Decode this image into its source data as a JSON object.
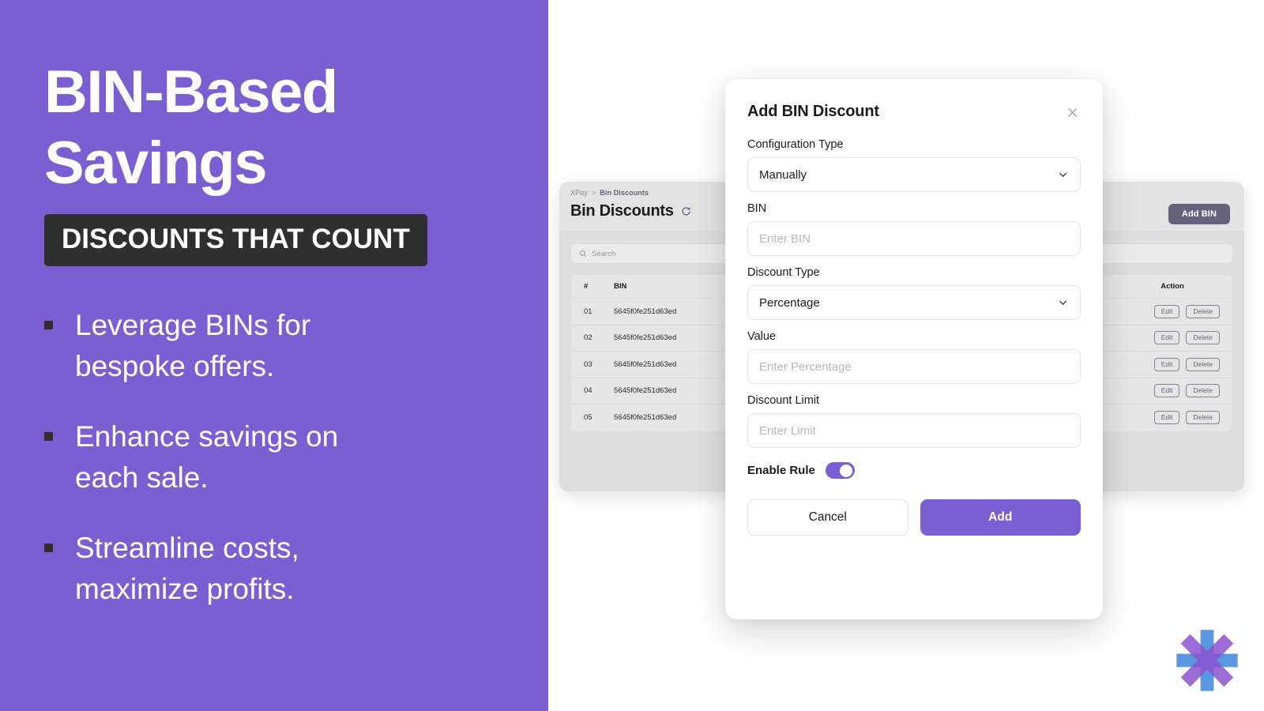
{
  "slide": {
    "headline_lines": [
      "BIN-Based",
      "Savings"
    ],
    "kicker": "DISCOUNTS THAT COUNT",
    "bullets": [
      "Leverage BINs for bespoke offers.",
      "Enhance savings on each sale.",
      "Streamline costs, maximize profits."
    ],
    "accent_purple": "#7a5fd3",
    "kicker_bg": "#2f2f2f"
  },
  "app": {
    "breadcrumb": {
      "root": "XPay",
      "separator": ">",
      "current": "Bin Discounts"
    },
    "page_title": "Bin Discounts",
    "refresh_icon": "refresh-icon",
    "add_bin_label": "Add BIN",
    "search_placeholder": "Search",
    "search_icon": "search-icon",
    "table": {
      "columns": [
        "#",
        "BIN",
        "Action"
      ],
      "rows": [
        {
          "num": "01",
          "bin": "5645f0fe251d63ed",
          "edit": "Edit",
          "delete": "Delete"
        },
        {
          "num": "02",
          "bin": "5645f0fe251d63ed",
          "edit": "Edit",
          "delete": "Delete"
        },
        {
          "num": "03",
          "bin": "5645f0fe251d63ed",
          "edit": "Edit",
          "delete": "Delete"
        },
        {
          "num": "04",
          "bin": "5645f0fe251d63ed",
          "edit": "Edit",
          "delete": "Delete"
        },
        {
          "num": "05",
          "bin": "5645f0fe251d63ed",
          "edit": "Edit",
          "delete": "Delete"
        }
      ]
    }
  },
  "modal": {
    "title": "Add BIN Discount",
    "close_icon": "close-icon",
    "fields": {
      "configuration_type": {
        "label": "Configuration Type",
        "value": "Manually",
        "icon": "chevron-down-icon"
      },
      "bin": {
        "label": "BIN",
        "placeholder": "Enter BIN",
        "value": ""
      },
      "discount_type": {
        "label": "Discount Type",
        "value": "Percentage",
        "icon": "chevron-down-icon"
      },
      "value": {
        "label": "Value",
        "placeholder": "Enter Percentage",
        "value": ""
      },
      "discount_limit": {
        "label": "Discount Limit",
        "placeholder": "Enter Limit",
        "value": ""
      }
    },
    "toggle": {
      "label": "Enable Rule",
      "state": "on"
    },
    "cancel_label": "Cancel",
    "add_label": "Add"
  },
  "logo": {
    "name": "xpay-asterisk-logo",
    "blue": "#5b96e0",
    "purple": "#8b54d0"
  }
}
